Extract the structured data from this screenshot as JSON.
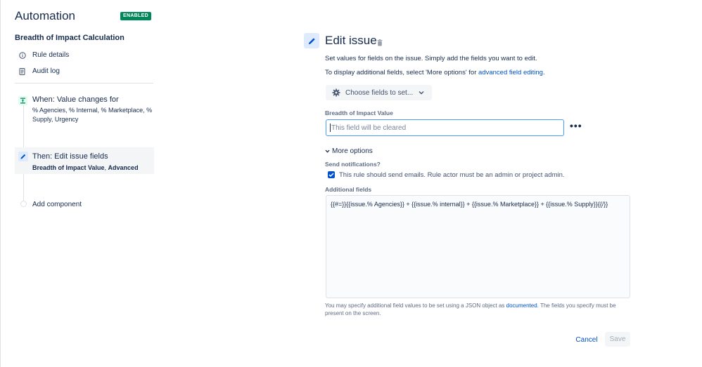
{
  "sidebar": {
    "app_title": "Automation",
    "status_badge": "ENABLED",
    "rule_title": "Breadth of Impact Calculation",
    "links": [
      {
        "label": "Rule details",
        "icon": "info-icon"
      },
      {
        "label": "Audit log",
        "icon": "document-icon"
      }
    ],
    "trigger": {
      "icon": "trigger-icon",
      "title": "When: Value changes for",
      "subtitle": "% Agencies, % Internal, % Marketplace, % Supply, Urgency"
    },
    "action": {
      "icon": "pencil-icon",
      "title": "Then: Edit issue fields",
      "subtitle_bold": "Breadth of Impact Value",
      "subtitle_sep": ", ",
      "subtitle_rest": "Advanced"
    },
    "add_component": "Add component"
  },
  "editor": {
    "title": "Edit issue",
    "description_1": "Set values for fields on the issue. Simply add the fields you want to edit.",
    "description_2_prefix": "To display additional fields, select 'More options' for ",
    "description_2_link": "advanced field editing",
    "description_2_suffix": ".",
    "choose_fields_label": "Choose fields to set...",
    "field_label": "Breadth of Impact Value",
    "field_placeholder": "This field will be cleared",
    "more_options_label": "More options",
    "send_notifications_label": "Send notifications?",
    "send_notifications_checked": true,
    "checkbox_label": "This rule should send emails. Rule actor must be an admin or project admin.",
    "additional_fields_label": "Additional fields",
    "additional_fields_value": "{{#=}}{{issue.% Agencies}} + {{issue.% internal}} + {{issue.% Marketplace}} + {{issue.% Supply}}{{/}}",
    "help_prefix": "You may specify additional field values to be set using a JSON object as ",
    "help_link": "documented",
    "help_suffix": ". The fields you specify must be present on the screen.",
    "cancel_label": "Cancel",
    "save_label": "Save"
  },
  "colors": {
    "badge_green": "#00875a",
    "link_blue": "#0052cc",
    "focus_blue": "#4c9aff",
    "text_dark": "#172b4d"
  }
}
